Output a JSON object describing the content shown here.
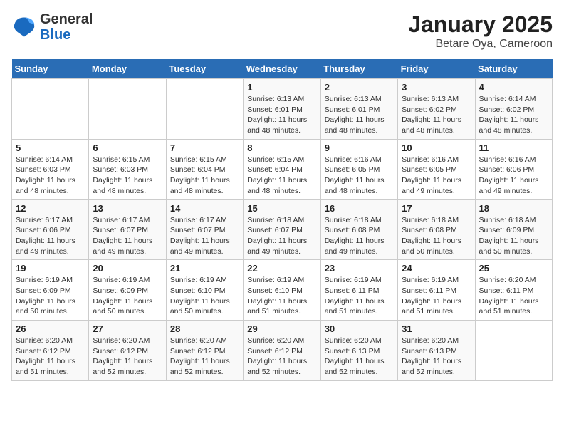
{
  "logo": {
    "general": "General",
    "blue": "Blue"
  },
  "title": "January 2025",
  "subtitle": "Betare Oya, Cameroon",
  "days_of_week": [
    "Sunday",
    "Monday",
    "Tuesday",
    "Wednesday",
    "Thursday",
    "Friday",
    "Saturday"
  ],
  "weeks": [
    [
      {
        "day": "",
        "detail": ""
      },
      {
        "day": "",
        "detail": ""
      },
      {
        "day": "",
        "detail": ""
      },
      {
        "day": "1",
        "detail": "Sunrise: 6:13 AM\nSunset: 6:01 PM\nDaylight: 11 hours\nand 48 minutes."
      },
      {
        "day": "2",
        "detail": "Sunrise: 6:13 AM\nSunset: 6:01 PM\nDaylight: 11 hours\nand 48 minutes."
      },
      {
        "day": "3",
        "detail": "Sunrise: 6:13 AM\nSunset: 6:02 PM\nDaylight: 11 hours\nand 48 minutes."
      },
      {
        "day": "4",
        "detail": "Sunrise: 6:14 AM\nSunset: 6:02 PM\nDaylight: 11 hours\nand 48 minutes."
      }
    ],
    [
      {
        "day": "5",
        "detail": "Sunrise: 6:14 AM\nSunset: 6:03 PM\nDaylight: 11 hours\nand 48 minutes."
      },
      {
        "day": "6",
        "detail": "Sunrise: 6:15 AM\nSunset: 6:03 PM\nDaylight: 11 hours\nand 48 minutes."
      },
      {
        "day": "7",
        "detail": "Sunrise: 6:15 AM\nSunset: 6:04 PM\nDaylight: 11 hours\nand 48 minutes."
      },
      {
        "day": "8",
        "detail": "Sunrise: 6:15 AM\nSunset: 6:04 PM\nDaylight: 11 hours\nand 48 minutes."
      },
      {
        "day": "9",
        "detail": "Sunrise: 6:16 AM\nSunset: 6:05 PM\nDaylight: 11 hours\nand 48 minutes."
      },
      {
        "day": "10",
        "detail": "Sunrise: 6:16 AM\nSunset: 6:05 PM\nDaylight: 11 hours\nand 49 minutes."
      },
      {
        "day": "11",
        "detail": "Sunrise: 6:16 AM\nSunset: 6:06 PM\nDaylight: 11 hours\nand 49 minutes."
      }
    ],
    [
      {
        "day": "12",
        "detail": "Sunrise: 6:17 AM\nSunset: 6:06 PM\nDaylight: 11 hours\nand 49 minutes."
      },
      {
        "day": "13",
        "detail": "Sunrise: 6:17 AM\nSunset: 6:07 PM\nDaylight: 11 hours\nand 49 minutes."
      },
      {
        "day": "14",
        "detail": "Sunrise: 6:17 AM\nSunset: 6:07 PM\nDaylight: 11 hours\nand 49 minutes."
      },
      {
        "day": "15",
        "detail": "Sunrise: 6:18 AM\nSunset: 6:07 PM\nDaylight: 11 hours\nand 49 minutes."
      },
      {
        "day": "16",
        "detail": "Sunrise: 6:18 AM\nSunset: 6:08 PM\nDaylight: 11 hours\nand 49 minutes."
      },
      {
        "day": "17",
        "detail": "Sunrise: 6:18 AM\nSunset: 6:08 PM\nDaylight: 11 hours\nand 50 minutes."
      },
      {
        "day": "18",
        "detail": "Sunrise: 6:18 AM\nSunset: 6:09 PM\nDaylight: 11 hours\nand 50 minutes."
      }
    ],
    [
      {
        "day": "19",
        "detail": "Sunrise: 6:19 AM\nSunset: 6:09 PM\nDaylight: 11 hours\nand 50 minutes."
      },
      {
        "day": "20",
        "detail": "Sunrise: 6:19 AM\nSunset: 6:09 PM\nDaylight: 11 hours\nand 50 minutes."
      },
      {
        "day": "21",
        "detail": "Sunrise: 6:19 AM\nSunset: 6:10 PM\nDaylight: 11 hours\nand 50 minutes."
      },
      {
        "day": "22",
        "detail": "Sunrise: 6:19 AM\nSunset: 6:10 PM\nDaylight: 11 hours\nand 51 minutes."
      },
      {
        "day": "23",
        "detail": "Sunrise: 6:19 AM\nSunset: 6:11 PM\nDaylight: 11 hours\nand 51 minutes."
      },
      {
        "day": "24",
        "detail": "Sunrise: 6:19 AM\nSunset: 6:11 PM\nDaylight: 11 hours\nand 51 minutes."
      },
      {
        "day": "25",
        "detail": "Sunrise: 6:20 AM\nSunset: 6:11 PM\nDaylight: 11 hours\nand 51 minutes."
      }
    ],
    [
      {
        "day": "26",
        "detail": "Sunrise: 6:20 AM\nSunset: 6:12 PM\nDaylight: 11 hours\nand 51 minutes."
      },
      {
        "day": "27",
        "detail": "Sunrise: 6:20 AM\nSunset: 6:12 PM\nDaylight: 11 hours\nand 52 minutes."
      },
      {
        "day": "28",
        "detail": "Sunrise: 6:20 AM\nSunset: 6:12 PM\nDaylight: 11 hours\nand 52 minutes."
      },
      {
        "day": "29",
        "detail": "Sunrise: 6:20 AM\nSunset: 6:12 PM\nDaylight: 11 hours\nand 52 minutes."
      },
      {
        "day": "30",
        "detail": "Sunrise: 6:20 AM\nSunset: 6:13 PM\nDaylight: 11 hours\nand 52 minutes."
      },
      {
        "day": "31",
        "detail": "Sunrise: 6:20 AM\nSunset: 6:13 PM\nDaylight: 11 hours\nand 52 minutes."
      },
      {
        "day": "",
        "detail": ""
      }
    ]
  ]
}
